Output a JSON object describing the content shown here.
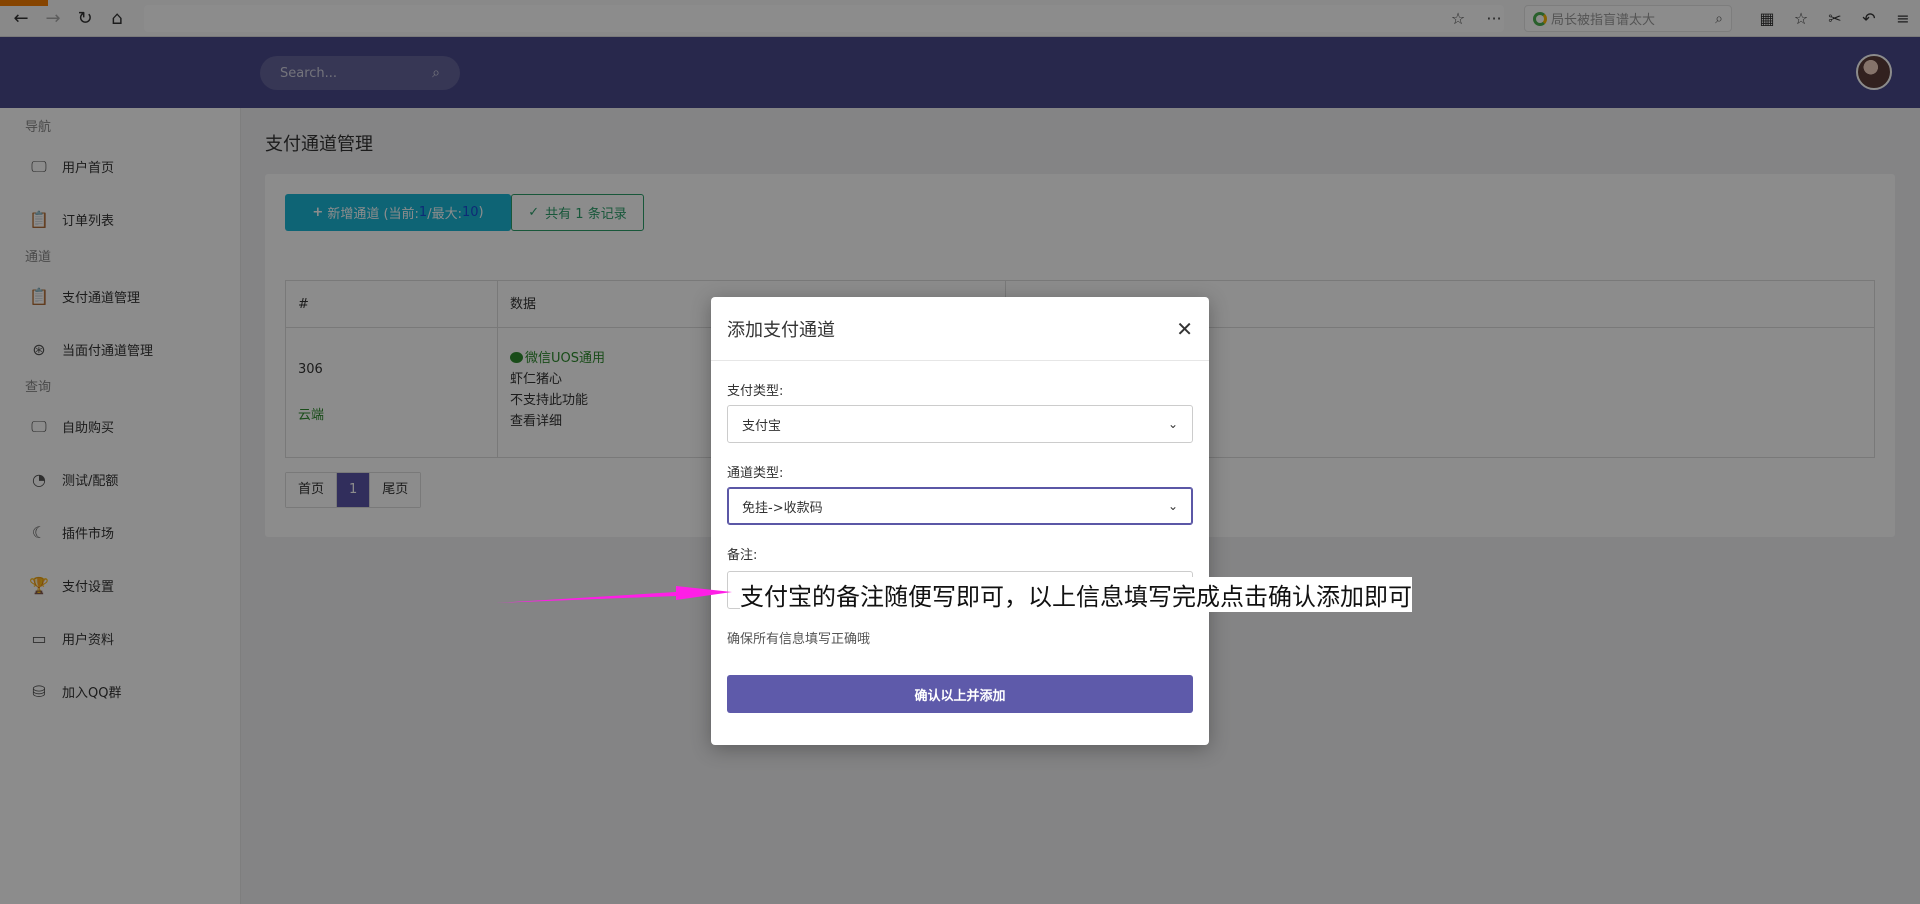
{
  "browser": {
    "search_placeholder": "局长被指盲谱太大"
  },
  "header": {
    "search_placeholder": "Search..."
  },
  "sidebar": {
    "sections": [
      {
        "title": "导航",
        "items": [
          {
            "label": "用户首页",
            "icon": "monitor-icon"
          },
          {
            "label": "订单列表",
            "icon": "clipboard-icon"
          }
        ]
      },
      {
        "title": "通道",
        "items": [
          {
            "label": "支付通道管理",
            "icon": "clipboard-icon"
          },
          {
            "label": "当面付通道管理",
            "icon": "lifebuoy-icon"
          }
        ]
      },
      {
        "title": "查询",
        "items": [
          {
            "label": "自助购买",
            "icon": "monitor-icon"
          },
          {
            "label": "测试/配额",
            "icon": "pie-chart-icon"
          },
          {
            "label": "插件市场",
            "icon": "leaf-icon"
          },
          {
            "label": "支付设置",
            "icon": "trophy-icon"
          },
          {
            "label": "用户资料",
            "icon": "card-icon"
          },
          {
            "label": "加入QQ群",
            "icon": "database-icon"
          }
        ]
      }
    ]
  },
  "main": {
    "title": "支付通道管理",
    "add_button": {
      "prefix": "新增通道 (当前: ",
      "current": "1",
      "mid": "/最大: ",
      "max": "10",
      "suffix": ")"
    },
    "count_label": "共有 1 条记录",
    "table": {
      "headers": [
        "#",
        "数据"
      ],
      "row": {
        "id": "306",
        "tag": "云端",
        "lines": [
          "微信UOS通用",
          "虾仁猪心",
          "不支持此功能",
          "查看详细"
        ]
      }
    },
    "pager": [
      "首页",
      "1",
      "尾页"
    ]
  },
  "modal": {
    "title": "添加支付通道",
    "pay_type_label": "支付类型:",
    "pay_type_value": "支付宝",
    "channel_type_label": "通道类型:",
    "channel_type_value": "免挂->收款码",
    "remark_label": "备注:",
    "remark_annotation": "支付宝的备注随便写即可，以上信息填写完成点击确认添加即可",
    "hint": "确保所有信息填写正确哦",
    "confirm_label": "确认以上并添加"
  },
  "colors": {
    "header_bg": "#4a4a8a",
    "accent": "#5e5aaa",
    "add_button": "#1ab7d5",
    "success": "#2c9e6b",
    "arrow": "#ff1ee6"
  }
}
